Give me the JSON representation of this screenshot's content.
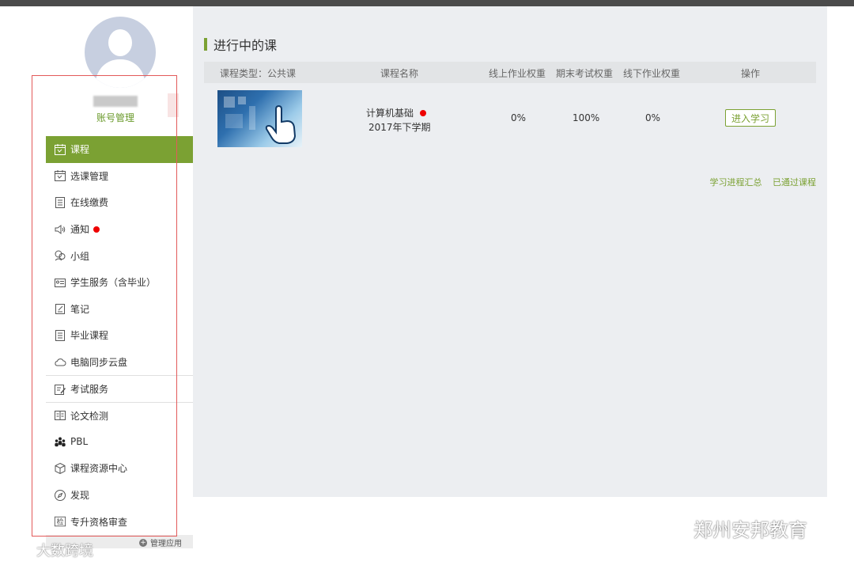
{
  "sidebar": {
    "account_label": "账号管理",
    "menu": [
      {
        "label": "课程",
        "icon": "calendar-icon",
        "active": true
      },
      {
        "label": "选课管理",
        "icon": "calendar-icon"
      },
      {
        "label": "在线缴费",
        "icon": "document-icon"
      },
      {
        "label": "通知",
        "icon": "speaker-icon",
        "badge": true
      },
      {
        "label": "小组",
        "icon": "group-icon"
      },
      {
        "label": "学生服务（含毕业）",
        "icon": "id-card-icon"
      },
      {
        "label": "笔记",
        "icon": "note-icon"
      },
      {
        "label": "毕业课程",
        "icon": "document-icon"
      },
      {
        "label": "电脑同步云盘",
        "icon": "cloud-icon"
      },
      {
        "label": "考试服务",
        "icon": "exam-icon"
      },
      {
        "label": "论文检测",
        "icon": "book-icon"
      },
      {
        "label": "PBL",
        "icon": "people-icon"
      },
      {
        "label": "课程资源中心",
        "icon": "cube-icon"
      },
      {
        "label": "发现",
        "icon": "compass-icon"
      },
      {
        "label": "专升资格审查",
        "icon": "check-badge-icon"
      }
    ],
    "manage_label": "管理应用",
    "manage_icon": "plus-icon"
  },
  "main": {
    "section_title": "进行中的课",
    "table": {
      "headers": [
        "课程类型：公共课",
        "课程名称",
        "线上作业权重",
        "期末考试权重",
        "线下作业权重",
        "操作"
      ],
      "rows": [
        {
          "course_name": "计算机基础",
          "term": "2017年下学期",
          "online_weight": "0%",
          "final_weight": "100%",
          "offline_weight": "0%",
          "action": "进入学习"
        }
      ]
    },
    "links": [
      "学习进程汇总",
      "已通过课程"
    ]
  },
  "watermarks": {
    "left": "大数跨境",
    "right": "郑州安邦教育"
  },
  "colors": {
    "accent": "#7ba133",
    "top_bar": "#4b4b4b",
    "main_bg": "#eceef1",
    "badge": "#e00000",
    "annotation_box": "#e35a5a"
  }
}
